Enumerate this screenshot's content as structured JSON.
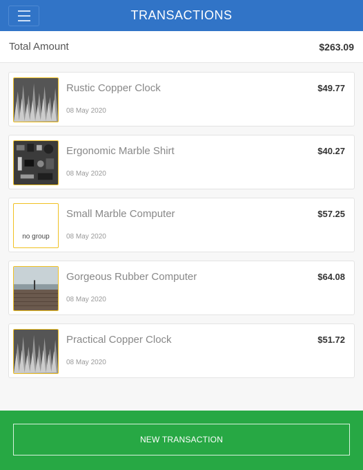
{
  "header": {
    "title": "TRANSACTIONS",
    "menu_icon": "hamburger-menu-icon"
  },
  "summary": {
    "label": "Total Amount",
    "value": "$263.09"
  },
  "transactions": [
    {
      "name": "Rustic Copper Clock",
      "date": "08 May 2020",
      "amount": "$49.77",
      "thumb": "grass-image"
    },
    {
      "name": "Ergonomic Marble Shirt",
      "date": "08 May 2020",
      "amount": "$40.27",
      "thumb": "desk-items-image"
    },
    {
      "name": "Small Marble Computer",
      "date": "08 May 2020",
      "amount": "$57.25",
      "thumb": "no-group",
      "thumb_label": "no group"
    },
    {
      "name": "Gorgeous Rubber Computer",
      "date": "08 May 2020",
      "amount": "$64.08",
      "thumb": "pier-image"
    },
    {
      "name": "Practical Copper Clock",
      "date": "08 May 2020",
      "amount": "$51.72",
      "thumb": "grass-image"
    }
  ],
  "footer": {
    "button_label": "NEW TRANSACTION"
  },
  "colors": {
    "header": "#3174c7",
    "footer": "#27a844",
    "thumb_border": "#f0c020"
  }
}
